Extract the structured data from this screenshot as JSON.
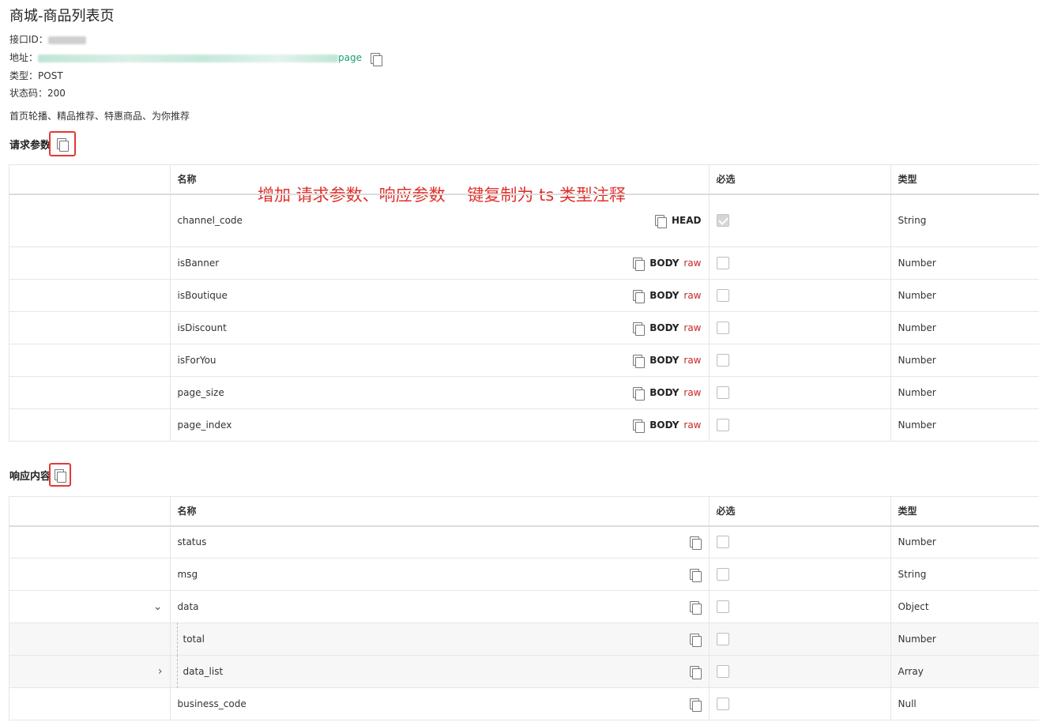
{
  "page": {
    "title": "商城-商品列表页"
  },
  "meta": {
    "interface_id_label": "接口ID：",
    "address_label": "地址：",
    "address_visible_suffix": "page",
    "type_label": "类型：",
    "type_value": "POST",
    "status_label": "状态码：",
    "status_value": "200",
    "description": "首页轮播、精品推荐、特惠商品、为你推荐"
  },
  "annotation": "增加 请求参数、响应参数 一键复制为 ts 类型注释",
  "request_section": {
    "title": "请求参数",
    "columns": [
      "名称",
      "必选",
      "类型"
    ],
    "rows": [
      {
        "name": "channel_code",
        "location": "HEAD",
        "raw": "",
        "required": true,
        "type": "String"
      },
      {
        "name": "isBanner",
        "location": "BODY",
        "raw": "raw",
        "required": false,
        "type": "Number"
      },
      {
        "name": "isBoutique",
        "location": "BODY",
        "raw": "raw",
        "required": false,
        "type": "Number"
      },
      {
        "name": "isDiscount",
        "location": "BODY",
        "raw": "raw",
        "required": false,
        "type": "Number"
      },
      {
        "name": "isForYou",
        "location": "BODY",
        "raw": "raw",
        "required": false,
        "type": "Number"
      },
      {
        "name": "page_size",
        "location": "BODY",
        "raw": "raw",
        "required": false,
        "type": "Number"
      },
      {
        "name": "page_index",
        "location": "BODY",
        "raw": "raw",
        "required": false,
        "type": "Number"
      }
    ]
  },
  "response_section": {
    "title": "响应内容",
    "columns": [
      "名称",
      "必选",
      "类型"
    ],
    "rows": [
      {
        "name": "status",
        "required": false,
        "type": "Number",
        "toggle": "",
        "child": false
      },
      {
        "name": "msg",
        "required": false,
        "type": "String",
        "toggle": "",
        "child": false
      },
      {
        "name": "data",
        "required": false,
        "type": "Object",
        "toggle": "⌄",
        "child": false
      },
      {
        "name": "total",
        "required": false,
        "type": "Number",
        "toggle": "",
        "child": true
      },
      {
        "name": "data_list",
        "required": false,
        "type": "Array",
        "toggle": "›",
        "child": true
      },
      {
        "name": "business_code",
        "required": false,
        "type": "Null",
        "toggle": "",
        "child": false
      }
    ]
  }
}
